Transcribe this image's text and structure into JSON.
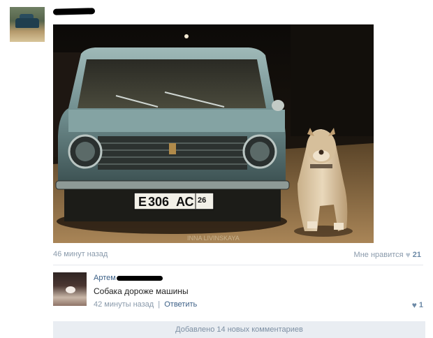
{
  "post": {
    "time": "46 минут назад",
    "like_label": "Мне нравится",
    "like_icon": "heart-icon",
    "like_count": "21",
    "photo_watermark": "INNA LIVINSKAYA",
    "plate": {
      "letter1": "Е",
      "number": "306",
      "letters": "АС",
      "region": "26"
    }
  },
  "comment": {
    "author": "Артем",
    "text": "Собака дороже машины",
    "time": "42 минуты назад",
    "separator": "|",
    "reply_label": "Ответить",
    "like_icon": "heart-icon",
    "like_count": "1"
  },
  "more_comments_label": "Добавлено 14 новых комментариев"
}
